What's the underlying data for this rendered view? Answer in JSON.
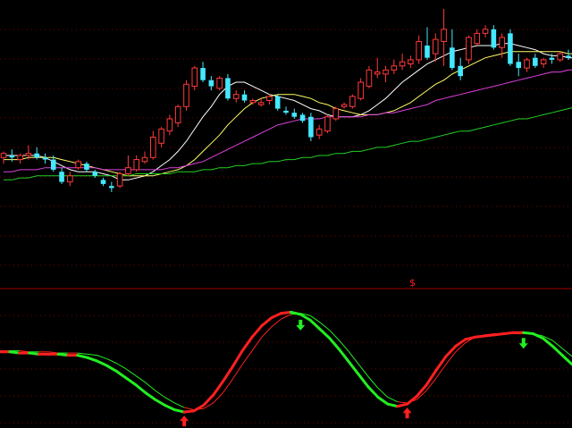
{
  "colors": {
    "background": "#000000",
    "grid": "#7a0000",
    "separator": "#a00000",
    "candle_up": "#ff3a3a",
    "candle_down": "#44e8ff",
    "ma_short": "#ffffff",
    "ma_mid": "#ffff66",
    "ma_long": "#e040e0",
    "ma_very_long": "#22d022",
    "osc_rise": "#ff2020",
    "osc_fall": "#22ee22",
    "osc_signal": "#22ee22",
    "marker": "#ff2020"
  },
  "marker_text": "$",
  "chart_data": [
    {
      "type": "candlestick",
      "title": "",
      "grid": true,
      "ylim": [
        0,
        100
      ],
      "candles": [
        {
          "o": 47,
          "h": 50,
          "l": 44,
          "c": 49
        },
        {
          "o": 48,
          "h": 51,
          "l": 45,
          "c": 47
        },
        {
          "o": 46,
          "h": 49,
          "l": 44,
          "c": 48
        },
        {
          "o": 48,
          "h": 53,
          "l": 46,
          "c": 49
        },
        {
          "o": 49,
          "h": 52,
          "l": 46,
          "c": 47
        },
        {
          "o": 47,
          "h": 49,
          "l": 44,
          "c": 46
        },
        {
          "o": 46,
          "h": 48,
          "l": 40,
          "c": 41
        },
        {
          "o": 40,
          "h": 42,
          "l": 34,
          "c": 35
        },
        {
          "o": 35,
          "h": 40,
          "l": 33,
          "c": 38
        },
        {
          "o": 42,
          "h": 46,
          "l": 41,
          "c": 45
        },
        {
          "o": 44,
          "h": 45,
          "l": 40,
          "c": 41
        },
        {
          "o": 40,
          "h": 41,
          "l": 37,
          "c": 38
        },
        {
          "o": 36,
          "h": 37,
          "l": 33,
          "c": 34
        },
        {
          "o": 33,
          "h": 35,
          "l": 30,
          "c": 32
        },
        {
          "o": 33,
          "h": 40,
          "l": 32,
          "c": 39
        },
        {
          "o": 39,
          "h": 48,
          "l": 38,
          "c": 42
        },
        {
          "o": 41,
          "h": 48,
          "l": 40,
          "c": 46
        },
        {
          "o": 45,
          "h": 50,
          "l": 44,
          "c": 47
        },
        {
          "o": 47,
          "h": 60,
          "l": 46,
          "c": 57
        },
        {
          "o": 54,
          "h": 62,
          "l": 52,
          "c": 61
        },
        {
          "o": 60,
          "h": 68,
          "l": 58,
          "c": 66
        },
        {
          "o": 64,
          "h": 73,
          "l": 62,
          "c": 72
        },
        {
          "o": 72,
          "h": 85,
          "l": 70,
          "c": 83
        },
        {
          "o": 82,
          "h": 92,
          "l": 80,
          "c": 91
        },
        {
          "o": 91,
          "h": 94,
          "l": 84,
          "c": 85
        },
        {
          "o": 85,
          "h": 87,
          "l": 80,
          "c": 82
        },
        {
          "o": 81,
          "h": 87,
          "l": 80,
          "c": 86
        },
        {
          "o": 86,
          "h": 88,
          "l": 75,
          "c": 76
        },
        {
          "o": 76,
          "h": 80,
          "l": 74,
          "c": 78
        },
        {
          "o": 78,
          "h": 80,
          "l": 74,
          "c": 75
        },
        {
          "o": 74,
          "h": 76,
          "l": 73,
          "c": 75
        },
        {
          "o": 73,
          "h": 76,
          "l": 72,
          "c": 74
        },
        {
          "o": 75,
          "h": 78,
          "l": 73,
          "c": 77
        },
        {
          "o": 77,
          "h": 78,
          "l": 70,
          "c": 71
        },
        {
          "o": 70,
          "h": 72,
          "l": 68,
          "c": 69
        },
        {
          "o": 69,
          "h": 71,
          "l": 66,
          "c": 67
        },
        {
          "o": 68,
          "h": 69,
          "l": 64,
          "c": 65
        },
        {
          "o": 67,
          "h": 69,
          "l": 55,
          "c": 57
        },
        {
          "o": 58,
          "h": 63,
          "l": 56,
          "c": 61
        },
        {
          "o": 60,
          "h": 68,
          "l": 59,
          "c": 67
        },
        {
          "o": 66,
          "h": 72,
          "l": 65,
          "c": 71
        },
        {
          "o": 72,
          "h": 74,
          "l": 71,
          "c": 73
        },
        {
          "o": 72,
          "h": 78,
          "l": 71,
          "c": 77
        },
        {
          "o": 76,
          "h": 86,
          "l": 75,
          "c": 84
        },
        {
          "o": 82,
          "h": 92,
          "l": 81,
          "c": 90
        },
        {
          "o": 88,
          "h": 96,
          "l": 86,
          "c": 89
        },
        {
          "o": 88,
          "h": 92,
          "l": 84,
          "c": 90
        },
        {
          "o": 90,
          "h": 95,
          "l": 88,
          "c": 92
        },
        {
          "o": 92,
          "h": 98,
          "l": 90,
          "c": 94
        },
        {
          "o": 93,
          "h": 97,
          "l": 91,
          "c": 95
        },
        {
          "o": 95,
          "h": 107,
          "l": 93,
          "c": 104
        },
        {
          "o": 102,
          "h": 111,
          "l": 95,
          "c": 96
        },
        {
          "o": 98,
          "h": 108,
          "l": 94,
          "c": 105
        },
        {
          "o": 104,
          "h": 120,
          "l": 92,
          "c": 110
        },
        {
          "o": 101,
          "h": 110,
          "l": 90,
          "c": 91
        },
        {
          "o": 92,
          "h": 96,
          "l": 85,
          "c": 87
        },
        {
          "o": 95,
          "h": 107,
          "l": 93,
          "c": 106
        },
        {
          "o": 103,
          "h": 110,
          "l": 102,
          "c": 108
        },
        {
          "o": 108,
          "h": 112,
          "l": 106,
          "c": 110
        },
        {
          "o": 110,
          "h": 112,
          "l": 100,
          "c": 101
        },
        {
          "o": 101,
          "h": 108,
          "l": 96,
          "c": 106
        },
        {
          "o": 108,
          "h": 110,
          "l": 92,
          "c": 93
        },
        {
          "o": 94,
          "h": 98,
          "l": 87,
          "c": 91
        },
        {
          "o": 91,
          "h": 96,
          "l": 89,
          "c": 95
        },
        {
          "o": 96,
          "h": 98,
          "l": 91,
          "c": 92
        },
        {
          "o": 93,
          "h": 96,
          "l": 91,
          "c": 95
        },
        {
          "o": 96,
          "h": 98,
          "l": 93,
          "c": 95
        },
        {
          "o": 95,
          "h": 99,
          "l": 94,
          "c": 98
        },
        {
          "o": 97,
          "h": 100,
          "l": 95,
          "c": 96
        }
      ],
      "ma_periods": [
        5,
        10,
        20,
        60
      ],
      "series": [
        {
          "values": [
            48,
            48,
            48,
            48,
            48,
            47,
            45,
            43,
            41,
            40,
            40,
            40,
            39,
            38,
            36,
            36,
            37,
            38,
            40,
            43,
            46,
            50,
            55,
            61,
            67,
            72,
            78,
            82,
            84,
            84,
            82,
            80,
            78,
            77,
            76,
            75,
            73,
            71,
            70,
            68,
            67,
            67,
            67,
            68,
            70,
            73,
            76,
            80,
            84,
            87,
            90,
            93,
            95,
            97,
            99,
            100,
            101,
            102,
            102,
            102,
            103,
            103,
            102,
            101,
            100,
            98,
            97,
            97,
            96,
            96
          ]
        },
        {
          "values": [
            46,
            46,
            46,
            47,
            47,
            47,
            47,
            46,
            45,
            44,
            43,
            42,
            41,
            40,
            39,
            38,
            38,
            38,
            38,
            39,
            40,
            41,
            43,
            46,
            50,
            54,
            58,
            63,
            67,
            71,
            74,
            76,
            77,
            78,
            78,
            78,
            77,
            76,
            74,
            73,
            71,
            70,
            69,
            68,
            68,
            68,
            69,
            70,
            72,
            74,
            77,
            80,
            83,
            85,
            88,
            90,
            92,
            94,
            96,
            97,
            98,
            99,
            99,
            99,
            99,
            99,
            99,
            99,
            98,
            98
          ]
        },
        {
          "values": [
            40,
            40,
            41,
            41,
            41,
            42,
            42,
            42,
            42,
            42,
            42,
            42,
            41,
            41,
            41,
            41,
            41,
            41,
            41,
            41,
            42,
            42,
            43,
            44,
            45,
            47,
            49,
            51,
            53,
            55,
            57,
            59,
            61,
            63,
            64,
            65,
            66,
            66,
            66,
            67,
            67,
            67,
            67,
            67,
            68,
            68,
            69,
            69,
            70,
            71,
            72,
            73,
            75,
            76,
            77,
            78,
            79,
            80,
            81,
            82,
            83,
            84,
            85,
            86,
            87,
            88,
            89,
            89,
            90,
            90
          ]
        },
        {
          "values": [
            36,
            36,
            37,
            37,
            38,
            38,
            38,
            38,
            38,
            38,
            38,
            38,
            38,
            38,
            38,
            38,
            39,
            39,
            39,
            39,
            39,
            40,
            40,
            40,
            41,
            41,
            42,
            42,
            43,
            43,
            44,
            44,
            45,
            45,
            46,
            46,
            47,
            47,
            48,
            48,
            49,
            49,
            50,
            50,
            51,
            52,
            52,
            53,
            54,
            55,
            55,
            56,
            57,
            58,
            59,
            60,
            60,
            61,
            62,
            63,
            64,
            65,
            66,
            66,
            67,
            68,
            69,
            70,
            71,
            72
          ]
        }
      ]
    },
    {
      "type": "line",
      "title": "",
      "grid": true,
      "ylim": [
        0,
        100
      ],
      "series": [
        {
          "values": [
            60,
            60,
            59,
            59,
            58,
            58,
            58,
            57,
            57,
            55,
            52,
            48,
            43,
            37,
            31,
            24,
            18,
            13,
            9,
            7,
            8,
            13,
            22,
            34,
            47,
            61,
            73,
            83,
            90,
            94,
            95,
            93,
            88,
            80,
            72,
            62,
            51,
            40,
            29,
            20,
            14,
            12,
            14,
            21,
            31,
            44,
            56,
            65,
            71,
            73,
            74,
            75,
            76,
            77,
            77,
            76,
            72,
            65,
            57,
            49
          ]
        },
        {
          "values": [
            61,
            61,
            61,
            60,
            60,
            60,
            59,
            59,
            59,
            58,
            57,
            54,
            50,
            45,
            39,
            33,
            26,
            20,
            15,
            11,
            9,
            10,
            15,
            24,
            36,
            49,
            61,
            73,
            82,
            89,
            93,
            94,
            92,
            86,
            79,
            70,
            60,
            49,
            38,
            28,
            20,
            16,
            15,
            18,
            26,
            37,
            49,
            60,
            68,
            73,
            75,
            76,
            76,
            76,
            76,
            76,
            74,
            70,
            63,
            56
          ]
        }
      ],
      "buy_signals": [
        19,
        42
      ],
      "sell_signals": [
        31,
        54
      ]
    }
  ]
}
